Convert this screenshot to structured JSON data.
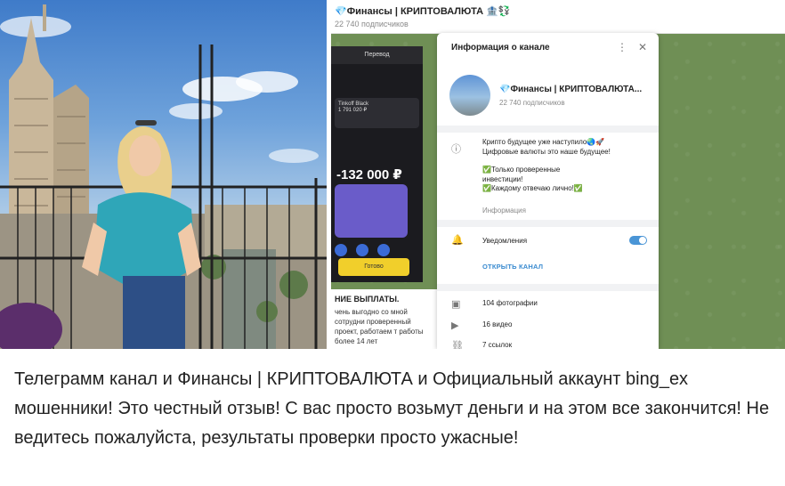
{
  "telegram": {
    "header_title": "💎Финансы | КРИПТОВАЛЮТА 🏦💱",
    "header_subscribers": "22 740 подписчиков"
  },
  "phone_mock": {
    "header": "Перевод",
    "card_name": "Tinkoff Black",
    "card_balance": "1 791 020 ₽",
    "amount": "-132 000 ₽",
    "button_label": "Готово"
  },
  "chat_message": {
    "heading": "НИЕ ВЫПЛАТЫ.",
    "text": "чень выгодно со мной сотрудни проверенный проект, работаем т работы более 14 лет"
  },
  "info_panel": {
    "title": "Информация о канале",
    "channel_name": "💎Финансы | КРИПТОВАЛЮТА...",
    "subscribers": "22 740 подписчиков",
    "about_line1": "Крипто будущее уже наступило🌏🚀",
    "about_line2": "Цифровые валюты это наше будущее!",
    "about_line3": "✅Только проверенные",
    "about_line4": "инвестиции!",
    "about_line5": "✅Каждому отвечаю лично!✅",
    "about_label": "Информация",
    "notifications_label": "Уведомления",
    "notifications_on": true,
    "open_channel": "ОТКРЫТЬ КАНАЛ",
    "photos": "104 фотографии",
    "videos": "16 видео",
    "links": "7 ссылок"
  },
  "caption": "Телеграмм канал и Финансы | КРИПТОВАЛЮТА и Официальный аккаунт bing_ex мошенники! Это честный отзыв! С вас просто возьмут деньги и на этом все закончится! Не ведитесь пожалуйста, результаты проверки просто ужасные!",
  "colors": {
    "accent": "#3a8bd0",
    "toggle": "#4a95d6",
    "chat_background": "#708f58"
  }
}
